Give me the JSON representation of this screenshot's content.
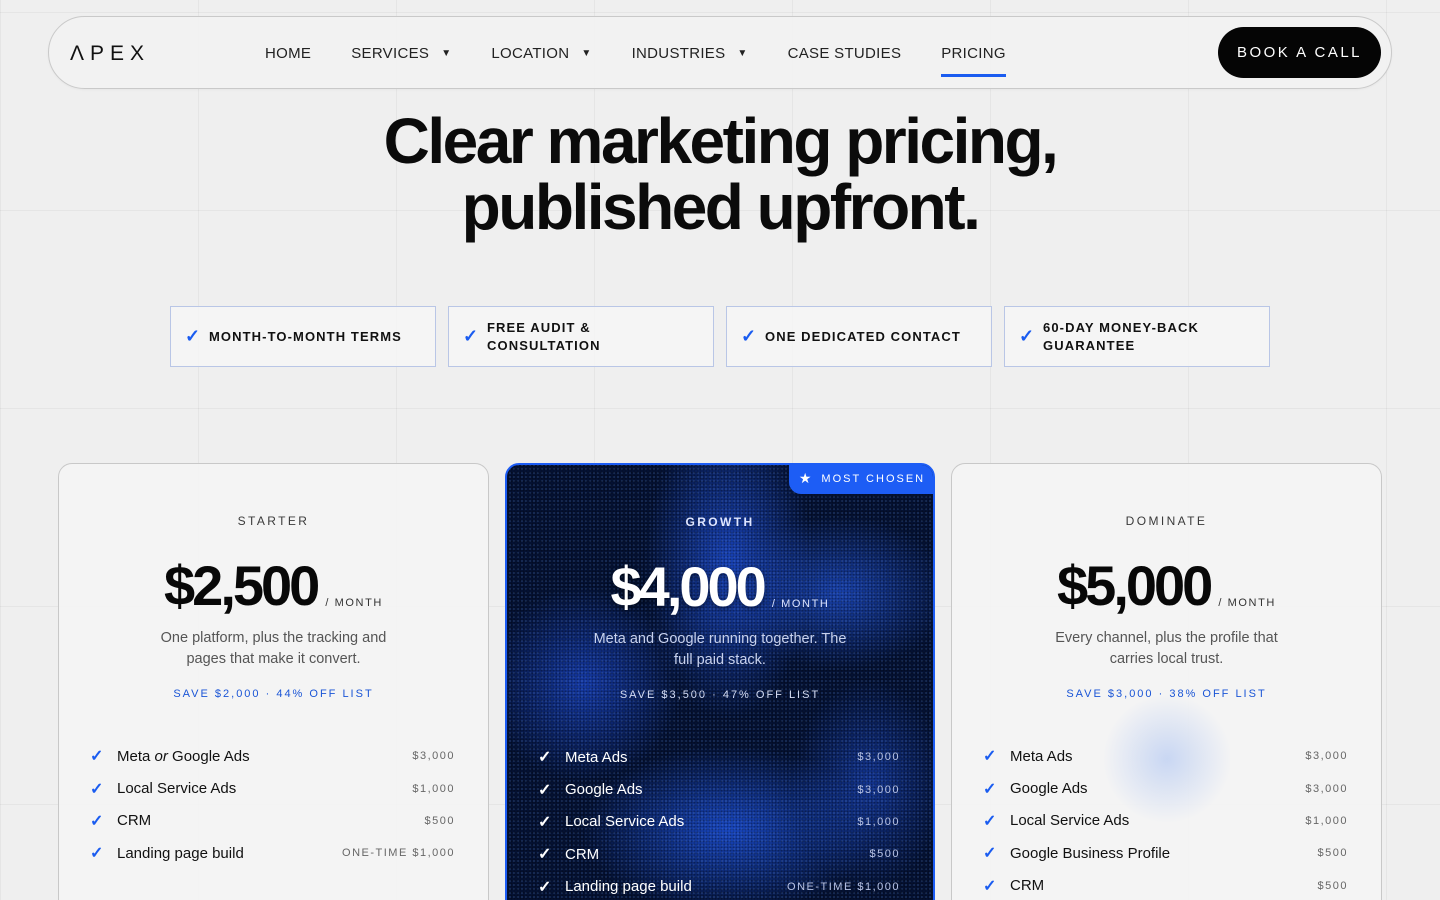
{
  "nav": {
    "logo": "ΛPEX",
    "items": [
      {
        "label": "HOME",
        "has_dropdown": false,
        "active": false
      },
      {
        "label": "SERVICES",
        "has_dropdown": true,
        "active": false
      },
      {
        "label": "LOCATION",
        "has_dropdown": true,
        "active": false
      },
      {
        "label": "INDUSTRIES",
        "has_dropdown": true,
        "active": false
      },
      {
        "label": "CASE STUDIES",
        "has_dropdown": false,
        "active": false
      },
      {
        "label": "PRICING",
        "has_dropdown": false,
        "active": true
      }
    ],
    "cta": "BOOK A CALL"
  },
  "hero": {
    "title_line1": "Clear marketing pricing,",
    "title_line2": "published upfront."
  },
  "features": [
    "MONTH-TO-MONTH TERMS",
    "FREE AUDIT &\nCONSULTATION",
    "ONE DEDICATED CONTACT",
    "60-DAY MONEY-BACK\nGUARANTEE"
  ],
  "plans": {
    "starter": {
      "tier": "STARTER",
      "price": "$2,500",
      "period": "/ MONTH",
      "desc": "One platform, plus the tracking and pages that make it convert.",
      "save": "SAVE $2,000 · 44% OFF LIST",
      "items": [
        {
          "name_a": "Meta ",
          "name_em": "or",
          "name_b": " Google Ads",
          "value": "$3,000"
        },
        {
          "name_a": "Local Service Ads",
          "name_em": "",
          "name_b": "",
          "value": "$1,000"
        },
        {
          "name_a": "CRM",
          "name_em": "",
          "name_b": "",
          "value": "$500"
        },
        {
          "name_a": "Landing page build",
          "name_em": "",
          "name_b": "",
          "value": "ONE-TIME $1,000"
        }
      ]
    },
    "growth": {
      "badge": "MOST CHOSEN",
      "tier": "GROWTH",
      "price": "$4,000",
      "period": "/ MONTH",
      "desc": "Meta and Google running together. The full paid stack.",
      "save": "SAVE $3,500 · 47% OFF LIST",
      "items": [
        {
          "name_a": "Meta Ads",
          "name_em": "",
          "name_b": "",
          "value": "$3,000"
        },
        {
          "name_a": "Google Ads",
          "name_em": "",
          "name_b": "",
          "value": "$3,000"
        },
        {
          "name_a": "Local Service Ads",
          "name_em": "",
          "name_b": "",
          "value": "$1,000"
        },
        {
          "name_a": "CRM",
          "name_em": "",
          "name_b": "",
          "value": "$500"
        },
        {
          "name_a": "Landing page build",
          "name_em": "",
          "name_b": "",
          "value": "ONE-TIME $1,000"
        }
      ]
    },
    "dominate": {
      "tier": "DOMINATE",
      "price": "$5,000",
      "period": "/ MONTH",
      "desc": "Every channel, plus the profile that carries local trust.",
      "save": "SAVE $3,000 · 38% OFF LIST",
      "items": [
        {
          "name_a": "Meta Ads",
          "name_em": "",
          "name_b": "",
          "value": "$3,000"
        },
        {
          "name_a": "Google Ads",
          "name_em": "",
          "name_b": "",
          "value": "$3,000"
        },
        {
          "name_a": "Local Service Ads",
          "name_em": "",
          "name_b": "",
          "value": "$1,000"
        },
        {
          "name_a": "Google Business Profile",
          "name_em": "",
          "name_b": "",
          "value": "$500"
        },
        {
          "name_a": "CRM",
          "name_em": "",
          "name_b": "",
          "value": "$500"
        }
      ]
    }
  },
  "colors": {
    "accent": "#1d5df5",
    "growth_bg": "#041235",
    "text": "#0a0a0a"
  },
  "icons": {
    "check": "check-icon",
    "star": "star-icon",
    "caret": "chevron-down-icon"
  }
}
